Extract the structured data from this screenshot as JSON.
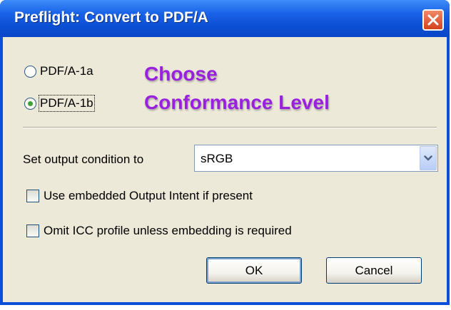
{
  "window": {
    "title": "Preflight: Convert to PDF/A"
  },
  "conformance": {
    "options": [
      {
        "label": "PDF/A-1a",
        "selected": false
      },
      {
        "label": "PDF/A-1b",
        "selected": true
      }
    ],
    "annotation_line1": "Choose",
    "annotation_line2": "Conformance Level"
  },
  "output_condition": {
    "label": "Set output condition to",
    "value": "sRGB"
  },
  "options": {
    "use_output_intent": {
      "label": "Use embedded Output Intent if present",
      "checked": false
    },
    "omit_icc": {
      "label": "Omit ICC profile unless embedding is required",
      "checked": false
    }
  },
  "buttons": {
    "ok": "OK",
    "cancel": "Cancel"
  },
  "colors": {
    "titlebar": "#0a4fd6",
    "annotation": "#9a20e0",
    "dialog_face": "#ece9d8"
  }
}
